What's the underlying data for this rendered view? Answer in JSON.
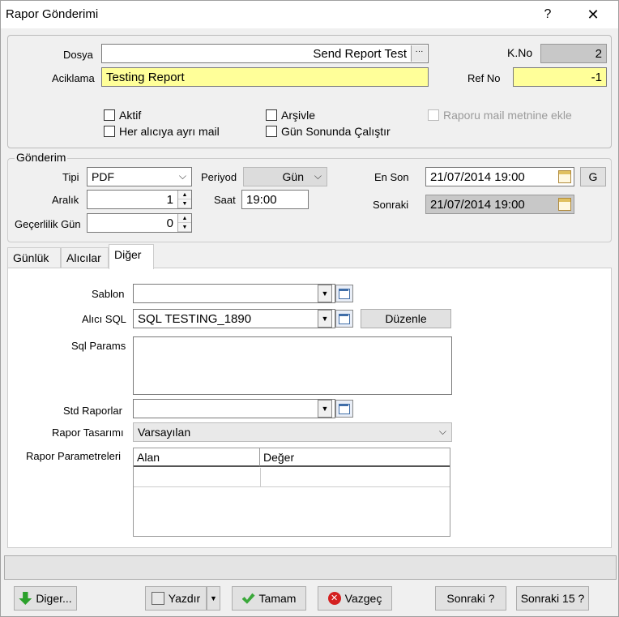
{
  "window": {
    "title": "Rapor Gönderimi",
    "help_label": "?",
    "close_label": "✕"
  },
  "top": {
    "dosya_label": "Dosya",
    "dosya_value": "Send Report Test",
    "dosya_browse": "···",
    "kno_label": "K.No",
    "kno_value": "2",
    "aciklama_label": "Aciklama",
    "aciklama_value": "Testing Report",
    "refno_label": "Ref No",
    "refno_value": "-1",
    "aktif_label": "Aktif",
    "arsivle_label": "Arşivle",
    "raporu_mail_label": "Raporu mail metnine ekle",
    "her_alici_label": "Her alıcıya ayrı mail",
    "gun_sonunda_label": "Gün Sonunda Çalıştır"
  },
  "gonderim": {
    "legend": "Gönderim",
    "tipi_label": "Tipi",
    "tipi_value": "PDF",
    "periyod_label": "Periyod",
    "periyod_value": "Gün",
    "en_son_label": "En Son",
    "en_son_value": "21/07/2014 19:00",
    "g_button": "G",
    "aralik_label": "Aralık",
    "aralik_value": "1",
    "saat_label": "Saat",
    "saat_value": "19:00",
    "sonraki_label": "Sonraki",
    "sonraki_value": "21/07/2014 19:00",
    "gecerlilik_label": "Geçerlilik Gün",
    "gecerlilik_value": "0"
  },
  "tabs": [
    {
      "label": "Günlük"
    },
    {
      "label": "Alıcılar"
    },
    {
      "label": "Diğer"
    }
  ],
  "diger": {
    "sablon_label": "Sablon",
    "sablon_value": "",
    "alici_sql_label": "Alıcı SQL",
    "alici_sql_value": "SQL TESTING_1890",
    "duzenle_label": "Düzenle",
    "sql_params_label": "Sql Params",
    "sql_params_value": "",
    "std_raporlar_label": "Std Raporlar",
    "std_raporlar_value": "",
    "rapor_tasarimi_label": "Rapor Tasarımı",
    "rapor_tasarimi_value": "Varsayılan",
    "rapor_parametreleri_label": "Rapor Parametreleri",
    "grid_columns": [
      "Alan",
      "Değer"
    ]
  },
  "footer": {
    "diger_label": "Diger...",
    "yazdir_label": "Yazdır",
    "tamam_label": "Tamam",
    "vazgec_label": "Vazgeç",
    "sonraki_label": "Sonraki ?",
    "sonraki15_label": "Sonraki 15 ?"
  },
  "icons": {
    "diger_icon": "green-down-arrow-icon",
    "yazdir_icon": "print-preview-icon",
    "tamam_icon": "green-check-icon",
    "vazgec_icon": "red-cancel-icon",
    "calendar_icon": "calendar-icon",
    "browse_icon": "browse-window-icon"
  },
  "colors": {
    "highlight_yellow": "#ffff99",
    "readonly_gray": "#c8c8c8"
  }
}
